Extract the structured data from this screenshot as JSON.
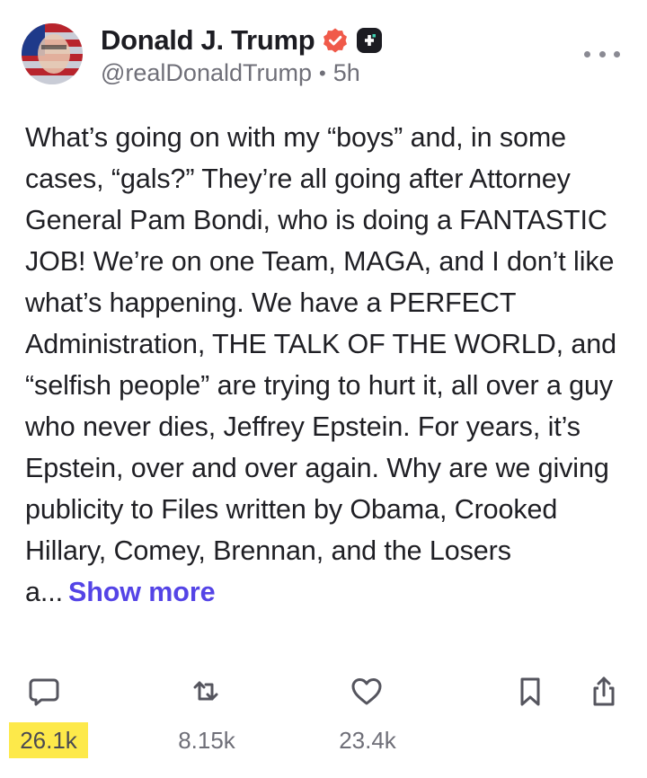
{
  "author": {
    "display_name": "Donald J. Trump",
    "handle": "@realDonaldTrump",
    "separator": "•",
    "time_ago": "5h",
    "verified_badge_color": "#f05a4a",
    "plus_badge_color": "#1c1c22"
  },
  "post": {
    "text": "What’s going on with my “boys” and, in some cases, “gals?” They’re all going after Attorney General Pam Bondi, who is doing a FANTASTIC JOB! We’re on one Team, MAGA, and I don’t like what’s happening. We have a PERFECT Administration, THE TALK OF THE WORLD, and “selfish people” are trying to hurt it, all over a guy who never dies, Jeffrey Epstein. For years, it’s Epstein, over and over again. Why are we giving publicity to Files written by Obama, Crooked Hillary, Comey, Brennan, and the Losers a...",
    "show_more_label": "Show more",
    "accent_color": "#5444e6"
  },
  "actions": {
    "reply_count": "26.1k",
    "retruth_count": "8.15k",
    "like_count": "23.4k",
    "icons": [
      "reply-icon",
      "retruth-icon",
      "like-icon",
      "bookmark-icon",
      "share-icon"
    ]
  }
}
